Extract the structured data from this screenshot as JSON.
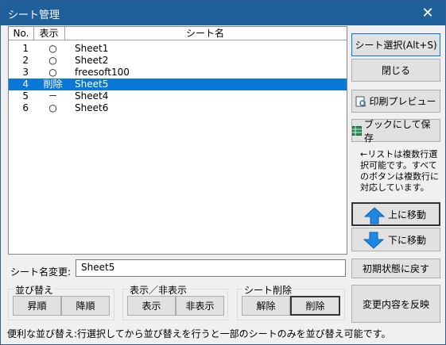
{
  "window": {
    "title": "シート管理",
    "close_glyph": "✕"
  },
  "list": {
    "headers": [
      "No.",
      "表示",
      "シート名"
    ],
    "rows": [
      {
        "no": "1",
        "disp": "○",
        "name": "Sheet1"
      },
      {
        "no": "2",
        "disp": "○",
        "name": "Sheet2"
      },
      {
        "no": "3",
        "disp": "○",
        "name": "freesoft100"
      },
      {
        "no": "4",
        "disp": "削除",
        "name": "Sheet5"
      },
      {
        "no": "5",
        "disp": "－",
        "name": "Sheet4"
      },
      {
        "no": "6",
        "disp": "○",
        "name": "Sheet6"
      }
    ],
    "selected_no": "4"
  },
  "right": {
    "select_sheet": "シート選択(Alt+S)",
    "close": "閉じる",
    "print_preview": "印刷プレビュー",
    "save_as_book": "ブックにして保存",
    "note": "←リストは複数行選択可能です。すべてのボタンは複数行に対応しています。",
    "move_up": "上に移動",
    "move_down": "下に移動",
    "reset": "初期状態に戻す",
    "apply": "変更内容を反映"
  },
  "rename": {
    "label": "シート名変更:",
    "value": "Sheet5"
  },
  "groups": {
    "sort": {
      "title": "並び替え",
      "asc": "昇順",
      "desc": "降順"
    },
    "visibility": {
      "title": "表示／非表示",
      "show": "表示",
      "hide": "非表示"
    },
    "delete": {
      "title": "シート削除",
      "undo": "解除",
      "delete": "削除"
    }
  },
  "footer": "便利な並び替え:行選択してから並び替えを行うと一部のシートのみを並び替え可能です。",
  "colors": {
    "title_bar": "#1f5f9a",
    "selection": "#0a78d7",
    "arrow": "#1e88e5"
  }
}
